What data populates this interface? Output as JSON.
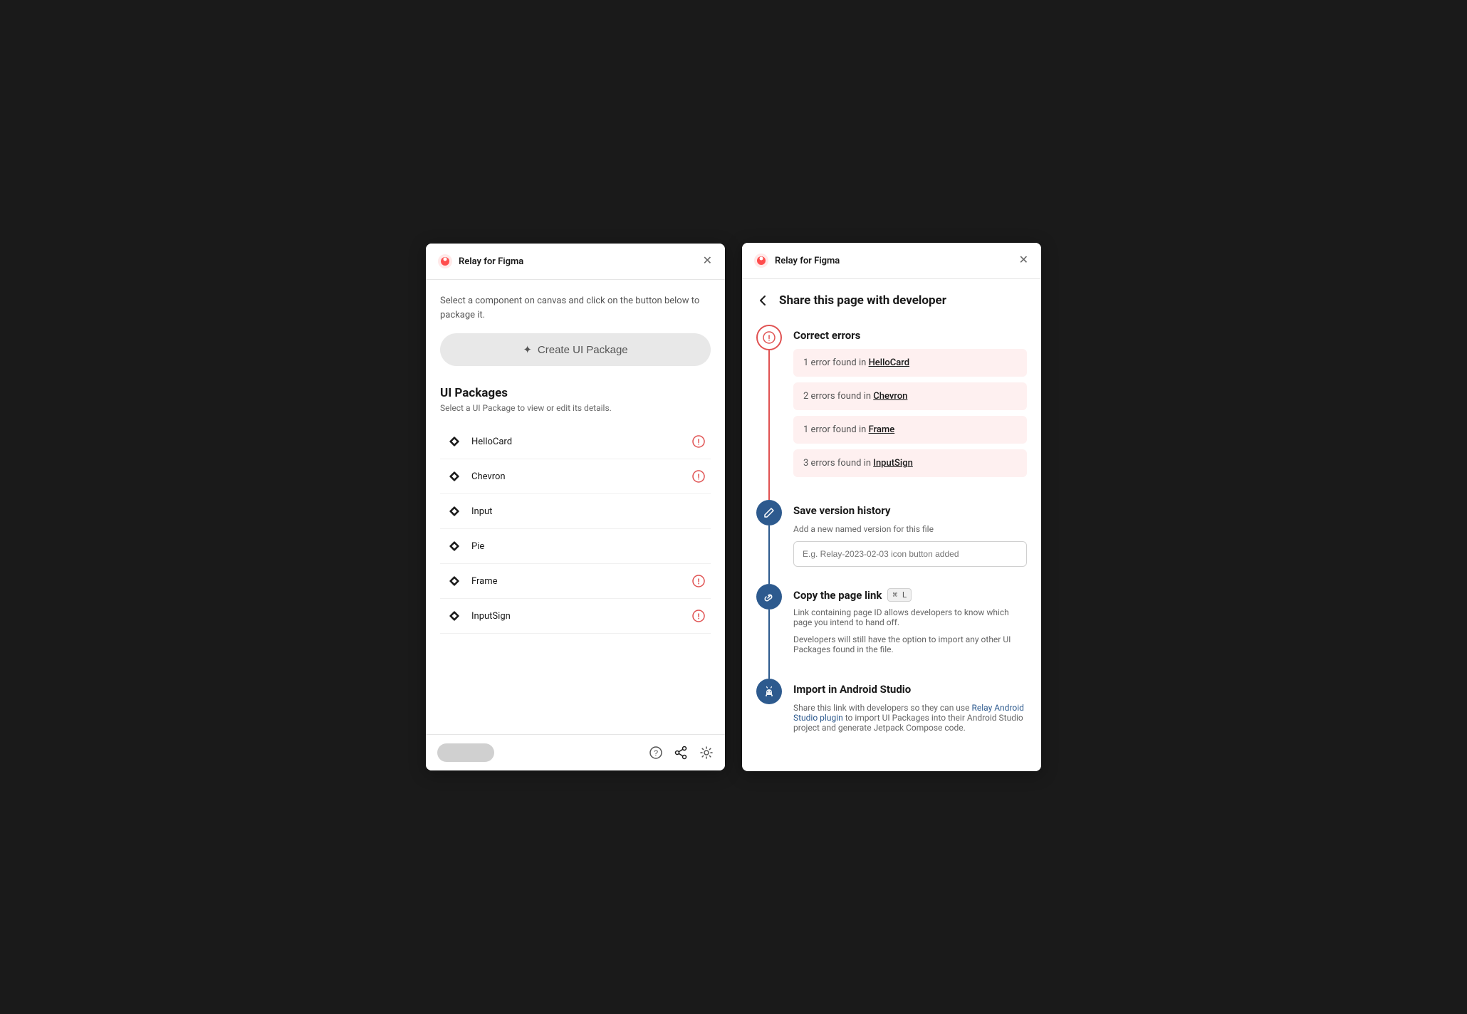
{
  "left_panel": {
    "title": "Relay for Figma",
    "instruction": "Select a component on canvas and click on the button below to package it.",
    "create_btn_label": "Create UI Package",
    "create_btn_icon": "✦",
    "packages_section_title": "UI Packages",
    "packages_section_subtitle": "Select a UI Package to view or edit its details.",
    "packages": [
      {
        "name": "HelloCard",
        "has_error": true
      },
      {
        "name": "Chevron",
        "has_error": true
      },
      {
        "name": "Input",
        "has_error": false
      },
      {
        "name": "Pie",
        "has_error": false
      },
      {
        "name": "Frame",
        "has_error": true
      },
      {
        "name": "InputSign",
        "has_error": true
      }
    ],
    "footer": {
      "help_icon": "?",
      "share_icon": "share",
      "settings_icon": "⚙"
    }
  },
  "right_panel": {
    "title": "Relay for Figma",
    "page_title": "Share this page with developer",
    "steps": [
      {
        "id": "correct-errors",
        "heading": "Correct errors",
        "line_color": "red",
        "errors": [
          {
            "text": "1 error found in ",
            "link": "HelloCard"
          },
          {
            "text": "2 errors found in ",
            "link": "Chevron"
          },
          {
            "text": "1 error found in ",
            "link": "Frame"
          },
          {
            "text": "3 errors found in ",
            "link": "InputSign"
          }
        ]
      },
      {
        "id": "save-version",
        "heading": "Save version history",
        "description": "Add a new named version for this file",
        "input_placeholder": "E.g. Relay-2023-02-03 icon button added",
        "line_color": "blue"
      },
      {
        "id": "copy-link",
        "heading": "Copy the page link",
        "shortcut": "⌘ L",
        "description1": "Link containing page ID allows developers to know which page you intend to hand off.",
        "description2": "Developers will still have the option to import any other UI Packages found in the file.",
        "line_color": "blue"
      },
      {
        "id": "android-studio",
        "heading": "Import in Android Studio",
        "description_prefix": "Share this link with developers so they can use ",
        "link_text": "Relay Android Studio plugin",
        "description_suffix": " to import UI Packages into their Android Studio project and generate Jetpack Compose code."
      }
    ]
  }
}
